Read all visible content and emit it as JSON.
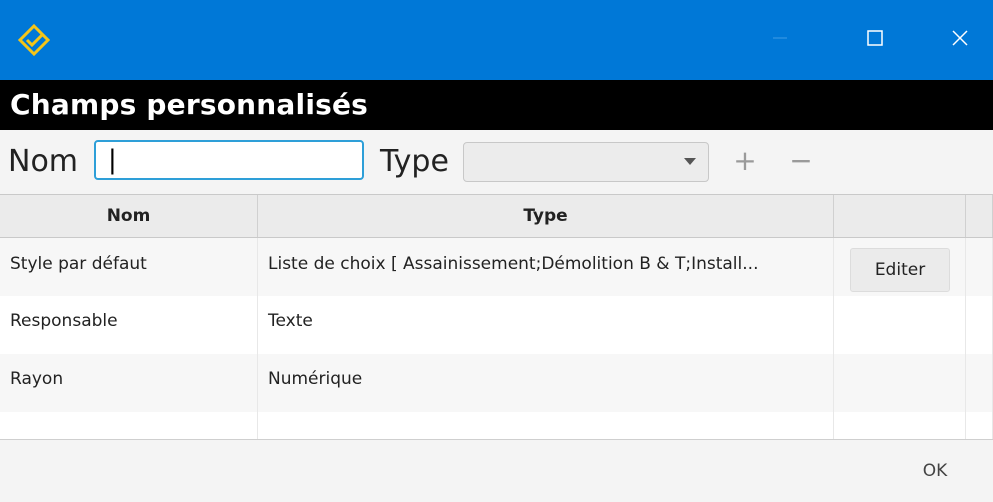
{
  "window": {
    "app_icon": "diamond-logo-icon",
    "controls": {
      "minimize": "—",
      "maximize": "□",
      "close": "✕"
    },
    "accent_color": "#0078d7"
  },
  "header": {
    "title": "Champs personnalisés"
  },
  "filter": {
    "nom_label": "Nom",
    "nom_value": "|",
    "type_label": "Type",
    "type_value": "",
    "add_label": "+",
    "remove_label": "−"
  },
  "table": {
    "columns": [
      "Nom",
      "Type",
      "",
      ""
    ],
    "rows": [
      {
        "nom": "Style par défaut",
        "type": "Liste de choix [ Assainissement;Démolition B & T;Install...",
        "action": "Editer"
      },
      {
        "nom": "Responsable",
        "type": "Texte",
        "action": ""
      },
      {
        "nom": "Rayon",
        "type": "Numérique",
        "action": ""
      }
    ]
  },
  "footer": {
    "ok_label": "OK"
  }
}
